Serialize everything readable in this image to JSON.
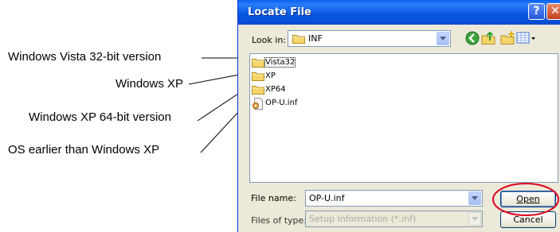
{
  "annotations": {
    "vista32": "Windows Vista 32-bit version",
    "xp": "Windows XP",
    "xp64": "Windows XP 64-bit version",
    "older": "OS earlier than Windows XP"
  },
  "dialog": {
    "title": "Locate File",
    "help_glyph": "?",
    "close_glyph": "✕",
    "look_in_label": "Look in:",
    "look_in_value": "INF",
    "files": [
      {
        "name": "Vista32",
        "icon": "folder-icon"
      },
      {
        "name": "XP",
        "icon": "folder-icon"
      },
      {
        "name": "XP64",
        "icon": "folder-icon"
      },
      {
        "name": "OP-U.inf",
        "icon": "setup-information-file-icon"
      }
    ],
    "file_name_label": "File name:",
    "file_name_value": "OP-U.inf",
    "files_of_type_label": "Files of type:",
    "files_of_type_value": "Setup Information (*.inf)",
    "open_label": "Open",
    "cancel_label": "Cancel"
  },
  "colors": {
    "titlebar": "#0a58e0",
    "dialog_bg": "#ece9d8",
    "highlight_ring": "#e0001b"
  }
}
